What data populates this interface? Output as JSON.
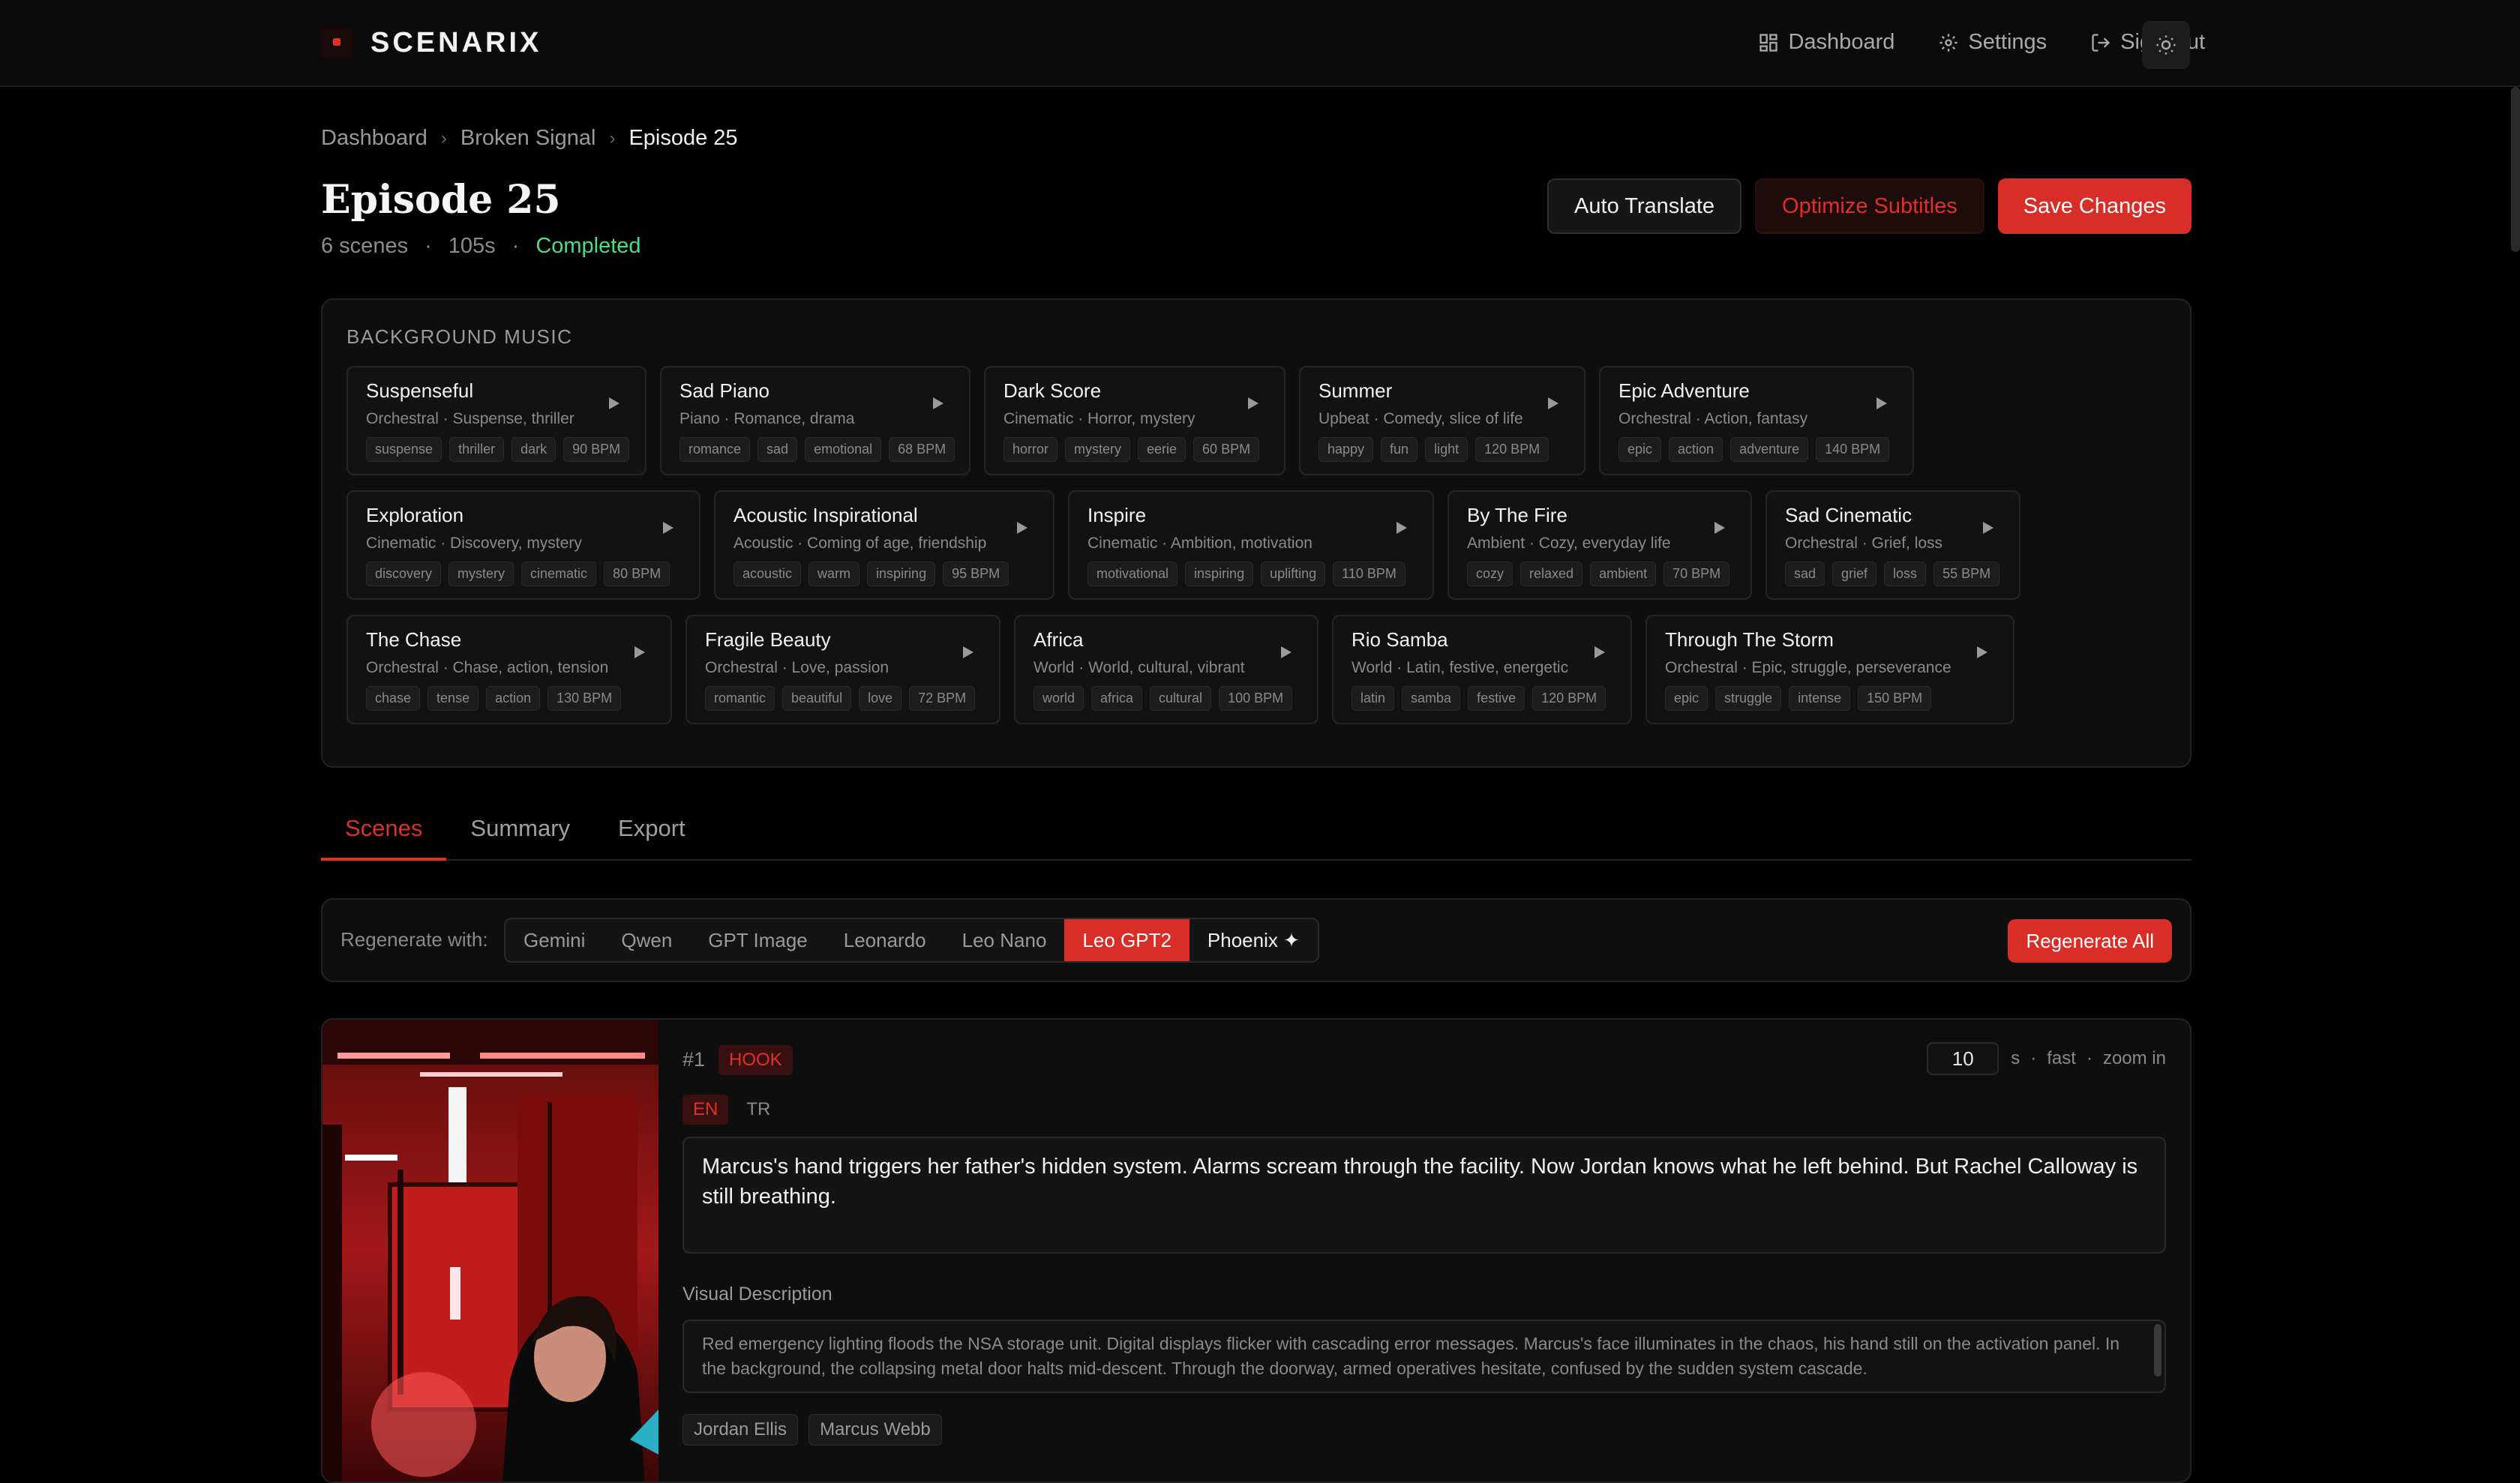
{
  "app": {
    "brand": "SCENARIX"
  },
  "nav": {
    "dashboard": "Dashboard",
    "settings": "Settings",
    "sign_out": "Sign Out"
  },
  "breadcrumb": {
    "root": "Dashboard",
    "series": "Broken Signal",
    "current": "Episode 25"
  },
  "header": {
    "title": "Episode 25",
    "scenes": "6 scenes",
    "duration": "105s",
    "status": "Completed",
    "auto_translate": "Auto Translate",
    "optimize": "Optimize Subtitles",
    "save": "Save Changes"
  },
  "music": {
    "label": "BACKGROUND MUSIC",
    "rows": [
      [
        {
          "title": "Suspenseful",
          "sub": "Orchestral · Suspense, thriller",
          "tags": [
            "suspense",
            "thriller",
            "dark",
            "90 BPM"
          ]
        },
        {
          "title": "Sad Piano",
          "sub": "Piano · Romance, drama",
          "tags": [
            "romance",
            "sad",
            "emotional",
            "68 BPM"
          ]
        },
        {
          "title": "Dark Score",
          "sub": "Cinematic · Horror, mystery",
          "tags": [
            "horror",
            "mystery",
            "eerie",
            "60 BPM"
          ]
        },
        {
          "title": "Summer",
          "sub": "Upbeat · Comedy, slice of life",
          "tags": [
            "happy",
            "fun",
            "light",
            "120 BPM"
          ]
        },
        {
          "title": "Epic Adventure",
          "sub": "Orchestral · Action, fantasy",
          "tags": [
            "epic",
            "action",
            "adventure",
            "140 BPM"
          ]
        }
      ],
      [
        {
          "title": "Exploration",
          "sub": "Cinematic · Discovery, mystery",
          "tags": [
            "discovery",
            "mystery",
            "cinematic",
            "80 BPM"
          ]
        },
        {
          "title": "Acoustic Inspirational",
          "sub": "Acoustic · Coming of age, friendship",
          "tags": [
            "acoustic",
            "warm",
            "inspiring",
            "95 BPM"
          ]
        },
        {
          "title": "Inspire",
          "sub": "Cinematic · Ambition, motivation",
          "tags": [
            "motivational",
            "inspiring",
            "uplifting",
            "110 BPM"
          ]
        },
        {
          "title": "By The Fire",
          "sub": "Ambient · Cozy, everyday life",
          "tags": [
            "cozy",
            "relaxed",
            "ambient",
            "70 BPM"
          ]
        },
        {
          "title": "Sad Cinematic",
          "sub": "Orchestral · Grief, loss",
          "tags": [
            "sad",
            "grief",
            "loss",
            "55 BPM"
          ]
        }
      ],
      [
        {
          "title": "The Chase",
          "sub": "Orchestral · Chase, action, tension",
          "tags": [
            "chase",
            "tense",
            "action",
            "130 BPM"
          ]
        },
        {
          "title": "Fragile Beauty",
          "sub": "Orchestral · Love, passion",
          "tags": [
            "romantic",
            "beautiful",
            "love",
            "72 BPM"
          ]
        },
        {
          "title": "Africa",
          "sub": "World · World, cultural, vibrant",
          "tags": [
            "world",
            "africa",
            "cultural",
            "100 BPM"
          ]
        },
        {
          "title": "Rio Samba",
          "sub": "World · Latin, festive, energetic",
          "tags": [
            "latin",
            "samba",
            "festive",
            "120 BPM"
          ]
        },
        {
          "title": "Through The Storm",
          "sub": "Orchestral · Epic, struggle, perseverance",
          "tags": [
            "epic",
            "struggle",
            "intense",
            "150 BPM"
          ]
        }
      ]
    ]
  },
  "tabs": [
    "Scenes",
    "Summary",
    "Export"
  ],
  "regen": {
    "label": "Regenerate with:",
    "models": [
      "Gemini",
      "Qwen",
      "GPT Image",
      "Leonardo",
      "Leo Nano",
      "Leo GPT2",
      "Phoenix ✦"
    ],
    "selected": "Leo GPT2",
    "all_button": "Regenerate All"
  },
  "scene": {
    "number": "#1",
    "type": "HOOK",
    "langs": [
      "EN",
      "TR"
    ],
    "active_lang": "EN",
    "duration_value": "10",
    "duration_unit": "s",
    "pace": "fast",
    "camera": "zoom in",
    "narration": "Marcus's hand triggers her father's hidden system. Alarms scream through the facility. Now Jordan knows what he left behind. But Rachel Calloway is still breathing.",
    "visual_label": "Visual Description",
    "visual": "Red emergency lighting floods the NSA storage unit. Digital displays flicker with cascading error messages. Marcus's face illuminates in the chaos, his hand still on the activation panel. In the background, the collapsing metal door halts mid-descent. Through the doorway, armed operatives hesitate, confused by the sudden system cascade.",
    "characters": [
      "Jordan Ellis",
      "Marcus Webb"
    ]
  },
  "colors": {
    "accent": "#d92d27",
    "status": "#4ade80",
    "background": "#000000"
  }
}
